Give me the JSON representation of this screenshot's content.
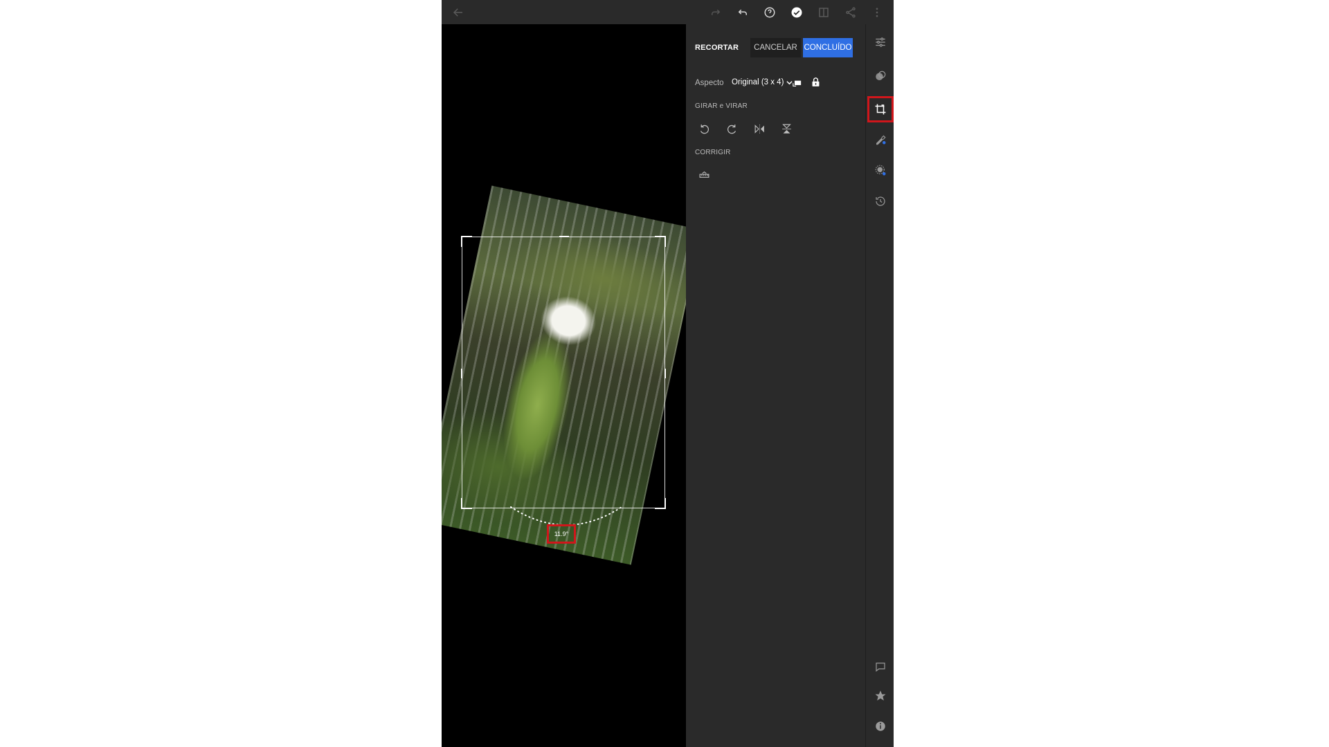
{
  "toolbar": {
    "icons": [
      "back-arrow-icon",
      "redo-icon",
      "undo-icon",
      "help-icon",
      "checkmark-icon",
      "compare-icon",
      "share-icon",
      "more-icon"
    ]
  },
  "canvas": {
    "angle_readout": "11.9°"
  },
  "panel": {
    "title": "RECORTAR",
    "cancel_label": "CANCELAR",
    "done_label": "CONCLUÍDO",
    "aspect_label": "Aspecto",
    "aspect_value": "Original (3 x 4)",
    "rotate_flip_label": "GIRAR e VIRAR",
    "straighten_label": "CORRIGIR"
  },
  "rail": {
    "icons": [
      "edit-sliders-icon",
      "presets-icon",
      "crop-icon",
      "healing-icon",
      "masking-icon",
      "history-icon",
      "comment-icon",
      "star-icon",
      "info-icon"
    ],
    "active": "crop-icon"
  },
  "colors": {
    "accent": "#2f6fe4",
    "highlight": "#d0161b",
    "panel_bg": "#2a2a2a"
  }
}
